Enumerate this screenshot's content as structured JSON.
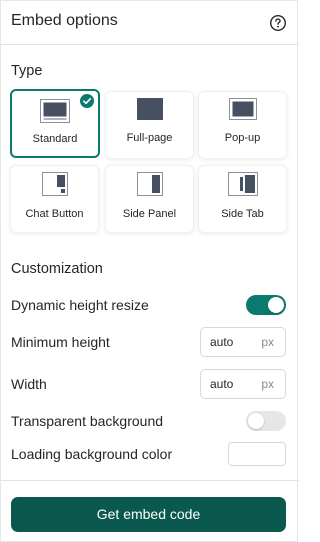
{
  "header": {
    "title": "Embed options",
    "help_icon": "help-circle-icon"
  },
  "type_section": {
    "title": "Type",
    "options": [
      {
        "label": "Standard",
        "icon": "standard-layout-icon",
        "selected": true
      },
      {
        "label": "Full-page",
        "icon": "full-page-layout-icon",
        "selected": false
      },
      {
        "label": "Pop-up",
        "icon": "popup-layout-icon",
        "selected": false
      },
      {
        "label": "Chat Button",
        "icon": "chat-button-layout-icon",
        "selected": false
      },
      {
        "label": "Side Panel",
        "icon": "side-panel-layout-icon",
        "selected": false
      },
      {
        "label": "Side Tab",
        "icon": "side-tab-layout-icon",
        "selected": false
      }
    ]
  },
  "customization": {
    "title": "Customization",
    "dynamic_height": {
      "label": "Dynamic height resize",
      "enabled": true
    },
    "min_height": {
      "label": "Minimum height",
      "value": "auto",
      "unit": "px"
    },
    "width": {
      "label": "Width",
      "value": "auto",
      "unit": "px"
    },
    "transparent_bg": {
      "label": "Transparent background",
      "enabled": false
    },
    "loading_bg": {
      "label": "Loading background color",
      "value": ""
    }
  },
  "footer": {
    "button_label": "Get embed code"
  },
  "colors": {
    "accent": "#0b7a6e",
    "button": "#0a584e",
    "thumb": "#475061"
  }
}
